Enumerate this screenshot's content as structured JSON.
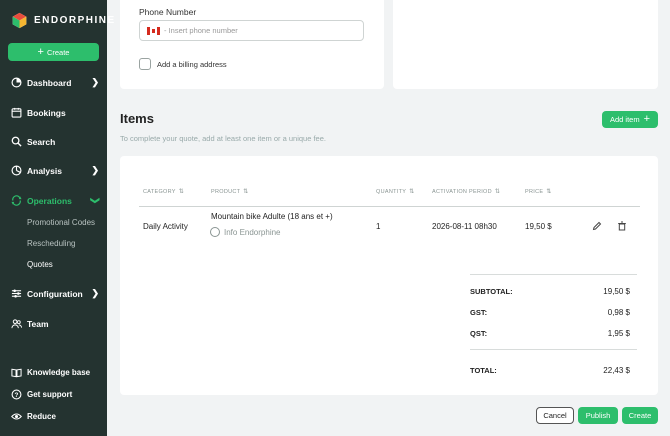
{
  "brand": {
    "name": "ENDORPHINE"
  },
  "sidebar": {
    "create_label": "Create",
    "items": [
      {
        "label": "Dashboard"
      },
      {
        "label": "Bookings"
      },
      {
        "label": "Search"
      },
      {
        "label": "Analysis"
      },
      {
        "label": "Operations"
      },
      {
        "label": "Configuration"
      },
      {
        "label": "Team"
      }
    ],
    "sub_items": [
      {
        "label": "Promotional Codes"
      },
      {
        "label": "Rescheduling"
      },
      {
        "label": "Quotes"
      }
    ],
    "bottom": [
      {
        "label": "Knowledge base"
      },
      {
        "label": "Get support"
      },
      {
        "label": "Reduce"
      }
    ]
  },
  "form": {
    "phone_label": "Phone Number",
    "phone_placeholder": "- Insert phone number",
    "billing_label": "Add a billing address"
  },
  "items": {
    "title": "Items",
    "subtitle": "To complete your quote, add at least one item or a unique fee.",
    "add_label": "Add item"
  },
  "table": {
    "columns": [
      "CATEGORY",
      "PRODUCT",
      "QUANTITY",
      "ACTIVATION PERIOD",
      "PRICE"
    ],
    "row": {
      "category": "Daily Activity",
      "product": "Mountain bike Adulte (18 ans et +)",
      "supplier": "Info Endorphine",
      "quantity": "1",
      "period": "2026-08-11 08h30",
      "price": "19,50 $"
    }
  },
  "summary": {
    "subtotal_label": "SUBTOTAL:",
    "subtotal": "19,50 $",
    "gst_label": "GST:",
    "gst": "0,98 $",
    "qst_label": "QST:",
    "qst": "1,95 $",
    "total_label": "TOTAL:",
    "total": "22,43 $"
  },
  "actions": {
    "cancel": "Cancel",
    "publish": "Publish",
    "create": "Create"
  },
  "colors": {
    "sidebar": "#243330",
    "accent": "#2dbe6c"
  }
}
